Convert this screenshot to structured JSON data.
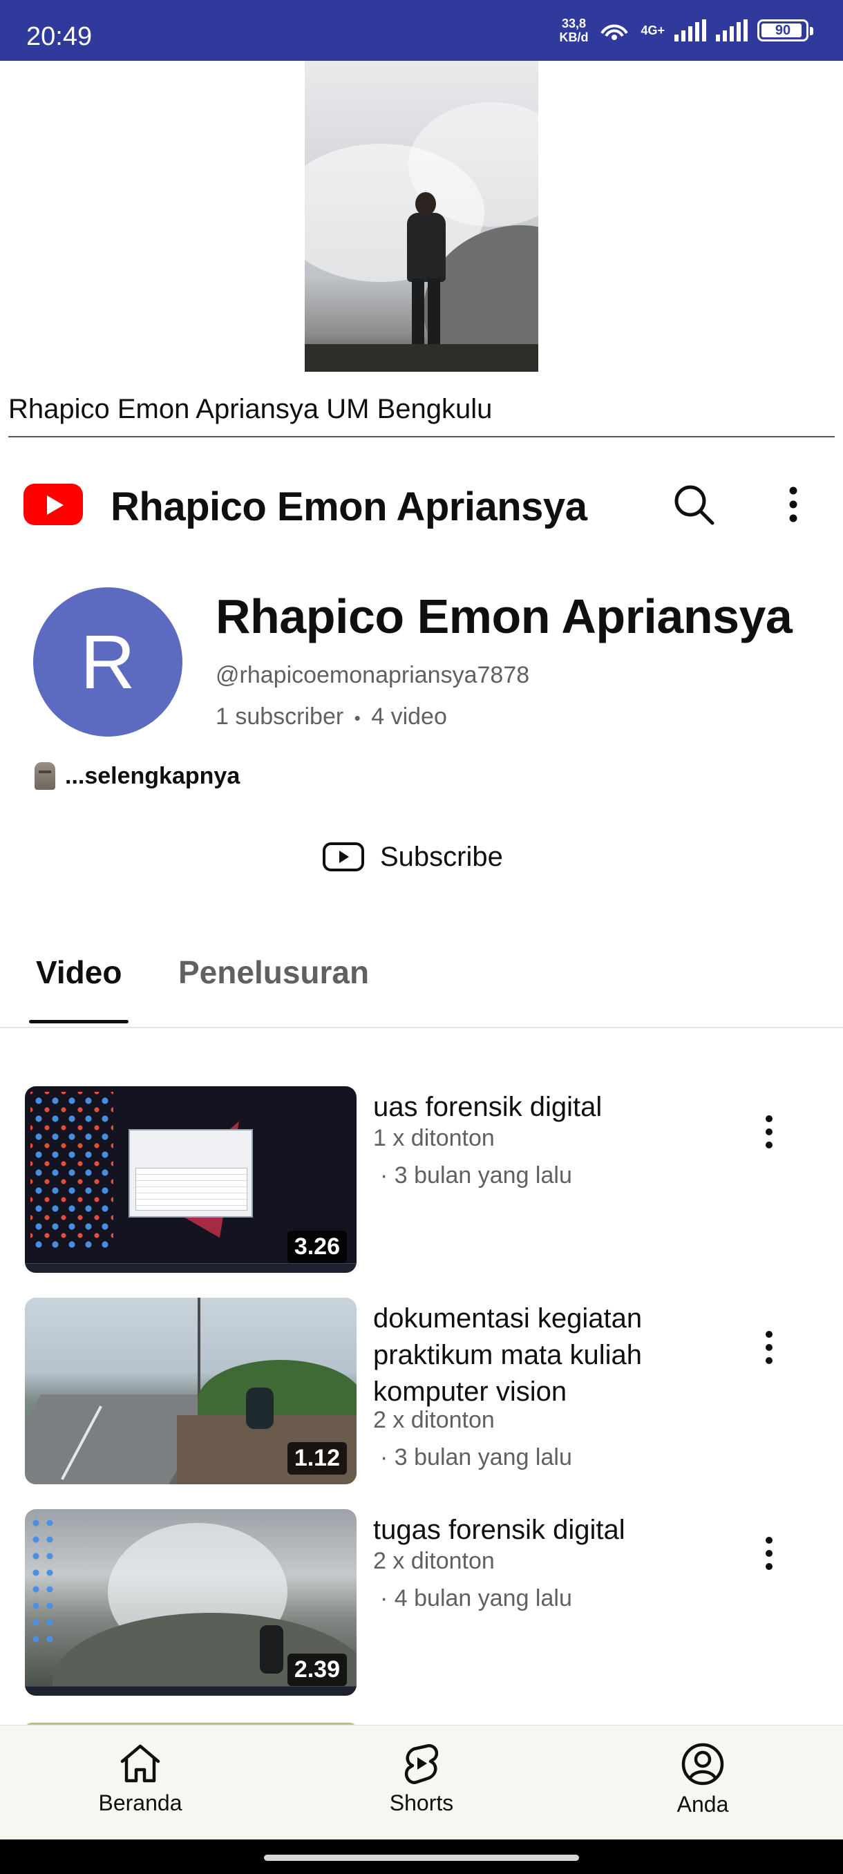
{
  "status_bar": {
    "time": "20:49",
    "net_speed_value": "33,8",
    "net_speed_unit": "KB/d",
    "network_type": "4G+",
    "battery": "90"
  },
  "banner": {
    "caption": "Rhapico Emon Apriansya UM Bengkulu"
  },
  "header": {
    "title": "Rhapico Emon Apriansya",
    "search_icon": "search-icon",
    "more_icon": "more-vert-icon"
  },
  "channel": {
    "avatar_letter": "R",
    "avatar_color": "#5c6bc0",
    "name": "Rhapico Emon Apriansya",
    "handle": "@rhapicoemonapriansya7878",
    "subscribers": "1 subscriber",
    "separator": "•",
    "video_count": "4 video",
    "description": "...selengkapnya",
    "subscribe_label": "Subscribe"
  },
  "tabs": [
    {
      "label": "Video",
      "active": true
    },
    {
      "label": "Penelusuran",
      "active": false
    }
  ],
  "videos": [
    {
      "title": "uas forensik digital",
      "duration": "3.26",
      "views": "1 x ditonton",
      "date": "· 3 bulan yang lalu"
    },
    {
      "title": "dokumentasi kegiatan praktikum mata kuliah komputer vision",
      "duration": "1.12",
      "views": "2 x ditonton",
      "date": "· 3 bulan yang lalu"
    },
    {
      "title": "tugas forensik digital",
      "duration": "2.39",
      "views": "2 x ditonton",
      "date": "· 4 bulan yang lalu"
    }
  ],
  "bottom_nav": [
    {
      "label": "Beranda",
      "icon": "home-icon"
    },
    {
      "label": "Shorts",
      "icon": "shorts-icon"
    },
    {
      "label": "Anda",
      "icon": "account-circle-icon"
    }
  ],
  "colors": {
    "status_bar": "#2f3a9c",
    "brand_red": "#ff0000",
    "secondary_text": "#606060"
  }
}
